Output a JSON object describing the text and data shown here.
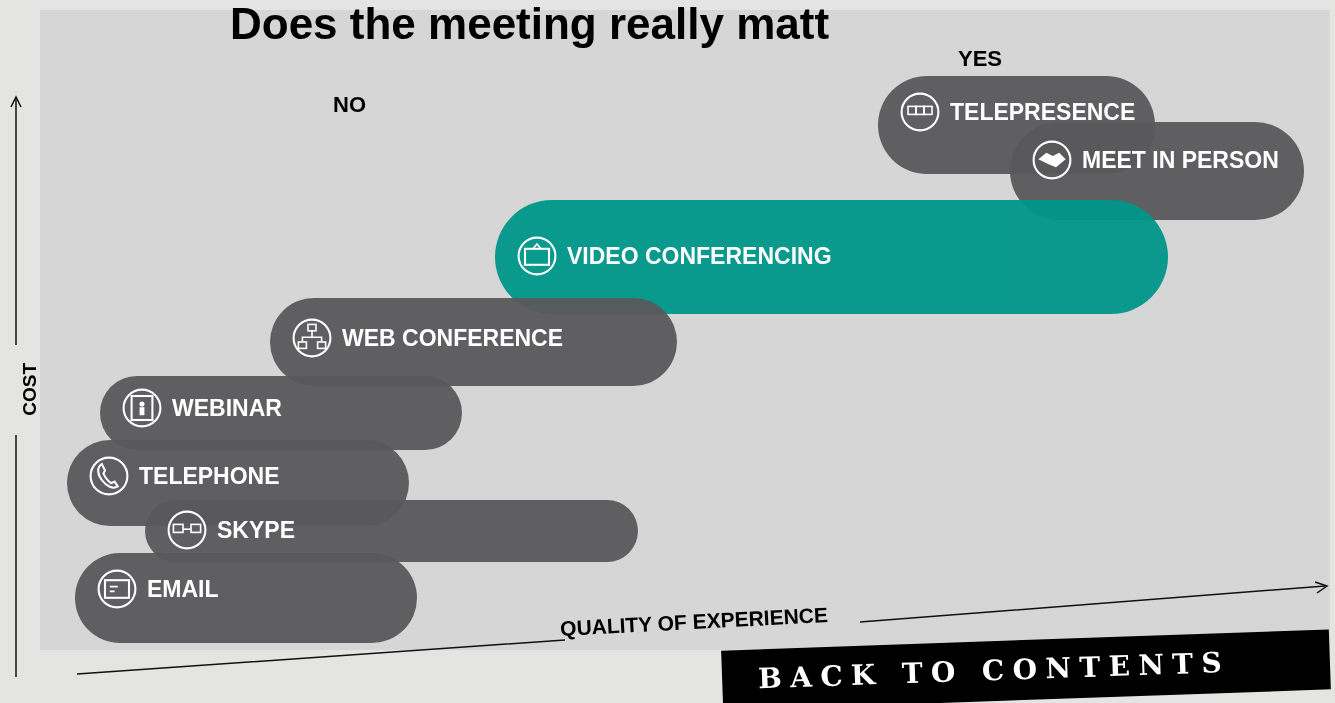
{
  "title": "Does the meeting really matt",
  "axis_labels": {
    "no": "NO",
    "yes": "YES",
    "cost": "COST",
    "quality": "QUALITY OF EXPERIENCE"
  },
  "options": [
    {
      "label": "TELEPRESENCE",
      "highlighted": false
    },
    {
      "label": "MEET IN PERSON",
      "highlighted": false
    },
    {
      "label": "VIDEO CONFERENCING",
      "highlighted": true
    },
    {
      "label": "WEB CONFERENCE",
      "highlighted": false
    },
    {
      "label": "WEBINAR",
      "highlighted": false
    },
    {
      "label": "TELEPHONE",
      "highlighted": false
    },
    {
      "label": "SKYPE",
      "highlighted": false
    },
    {
      "label": "EMAIL",
      "highlighted": false
    }
  ],
  "back_button": "BACK TO CONTENTS"
}
